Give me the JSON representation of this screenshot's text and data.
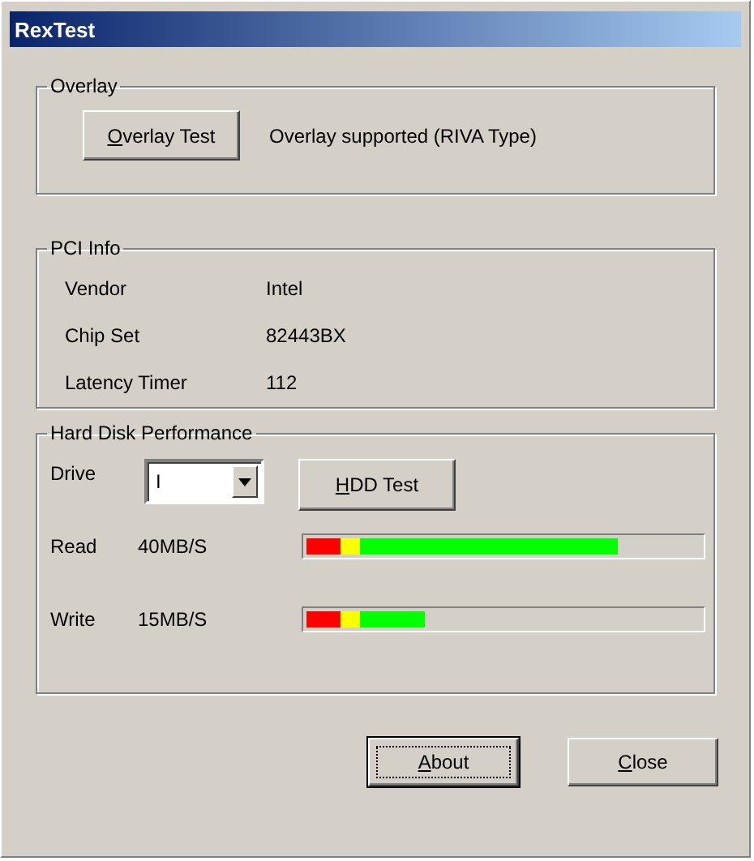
{
  "window": {
    "title": "RexTest"
  },
  "overlay": {
    "title": "Overlay",
    "button": {
      "label": "Overlay Test",
      "underline_first": true
    },
    "status": "Overlay supported (RIVA Type)"
  },
  "pci_info": {
    "title": "PCI Info",
    "rows": [
      {
        "label": "Vendor",
        "value": "Intel"
      },
      {
        "label": "Chip Set",
        "value": "82443BX"
      },
      {
        "label": "Latency Timer",
        "value": "112"
      }
    ]
  },
  "hard_disk": {
    "title": "Hard Disk Performance",
    "drive_label": "Drive",
    "drive_value": "I",
    "button": {
      "label": "HDD Test",
      "underline_first": true
    },
    "meters": [
      {
        "label": "Read",
        "reading": "40MB/S",
        "level": 0.79
      },
      {
        "label": "Write",
        "reading": "15MB/S",
        "level": 0.3
      }
    ]
  },
  "buttons": [
    {
      "label": "About",
      "underline_first": true,
      "focused": true
    },
    {
      "label": "Close",
      "underline_first": true,
      "focused": false
    }
  ]
}
